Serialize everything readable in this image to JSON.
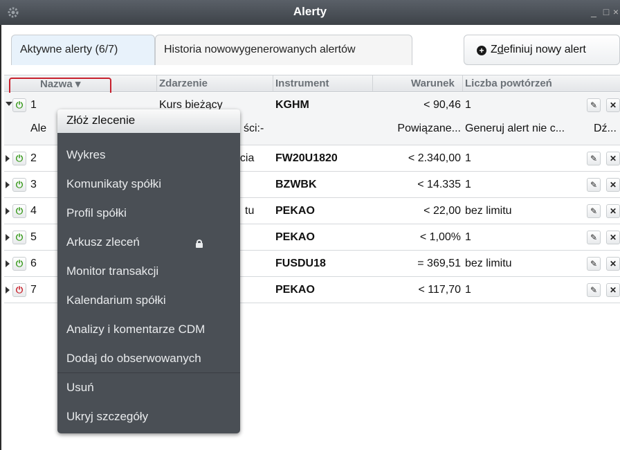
{
  "window": {
    "title": "Alerty",
    "minimize": "_",
    "maximize": "□",
    "close": "×",
    "settings_icon": "gear-icon"
  },
  "tabs": [
    {
      "label": "Aktywne alerty (6/7)",
      "active": true
    },
    {
      "label": "Historia nowowygenerowanych alertów",
      "active": false
    }
  ],
  "new_alert_button": {
    "label_prefix": "Z",
    "label_underlined": "d",
    "label_rest": "efiniuj nowy alert"
  },
  "columns": {
    "name": "Nazwa ▾",
    "event": "Zdarzenie",
    "instrument": "Instrument",
    "condition": "Warunek",
    "repeats": "Liczba powtórzeń"
  },
  "rows": [
    {
      "id": "1",
      "event": "Kurs bieżący",
      "instrument": "KGHM",
      "condition": "< 90,46",
      "repeats": "1",
      "status": "on",
      "expanded": true,
      "details": {
        "name": "Ale",
        "event": "ści:-",
        "condition": "Powiązane...",
        "repeats": "Generuj alert nie c...",
        "extra": "Dź..."
      }
    },
    {
      "id": "2",
      "event": "ęcia",
      "instrument": "FW20U1820",
      "condition": "< 2.340,00",
      "repeats": "1",
      "status": "on"
    },
    {
      "id": "3",
      "event": "",
      "instrument": "BZWBK",
      "condition": "< 14.335",
      "repeats": "1",
      "status": "on"
    },
    {
      "id": "4",
      "event": "tu",
      "instrument": "PEKAO",
      "condition": "< 22,00",
      "repeats": "bez limitu",
      "status": "on"
    },
    {
      "id": "5",
      "event": "",
      "instrument": "PEKAO",
      "condition": "< 1,00%",
      "repeats": "1",
      "status": "on"
    },
    {
      "id": "6",
      "event": "",
      "instrument": "FUSDU18",
      "condition": "= 369,51",
      "repeats": "bez limitu",
      "status": "on"
    },
    {
      "id": "7",
      "event": "",
      "instrument": "PEKAO",
      "condition": "< 117,70",
      "repeats": "1",
      "status": "off"
    }
  ],
  "context_menu": {
    "items": [
      "Złóż zlecenie",
      "Wykres",
      "Komunikaty spółki",
      "Profil spółki",
      "Arkusz zleceń",
      "Monitor transakcji",
      "Kalendarium spółki",
      "Analizy i komentarze CDM",
      "Dodaj do obserwowanych",
      "Usuń",
      "Ukryj szczegóły"
    ],
    "locked_item": "Arkusz zleceń"
  },
  "colors": {
    "titlebar": "#4a4f55",
    "menu_bg": "#4a4f55",
    "power_on": "#3a9b1e",
    "power_off": "#c8202a",
    "sort_highlight": "#c7202d"
  }
}
